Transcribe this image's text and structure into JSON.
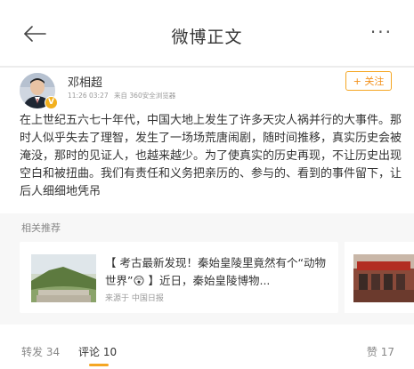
{
  "header": {
    "title": "微博正文",
    "more_label": "···"
  },
  "post": {
    "username": "邓相超",
    "time": "11:26 03:27",
    "source": "来自 360安全浏览器",
    "follow_label": "+ 关注",
    "verified_badge": "V",
    "text": "在上世纪五六七十年代，中国大地上发生了许多天灾人祸并行的大事件。那时人似乎失去了理智，发生了一场场荒唐闹剧，随时间推移，真实历史会被淹没，那时的见证人，也越来越少。为了使真实的历史再现，不让历史出现空白和被扭曲。我们有责任和义务把亲历的、参与的、看到的事件留下，让后人细细地凭吊"
  },
  "related": {
    "title": "相关推荐",
    "card": {
      "title": "【 考古最新发现！秦始皇陵里竟然有个“动物世界”😲 】近日，秦始皇陵博物...",
      "source": "来源于 中国日报"
    }
  },
  "bottom": {
    "repost_label": "转发 34",
    "comment_label": "评论 10",
    "like_label": "赞 17"
  },
  "colors": {
    "accent": "#f5a623",
    "separator": "#ececec",
    "panel": "#f7f7f7"
  },
  "icons": {
    "back": "back-arrow-icon",
    "more": "more-dots-icon"
  }
}
